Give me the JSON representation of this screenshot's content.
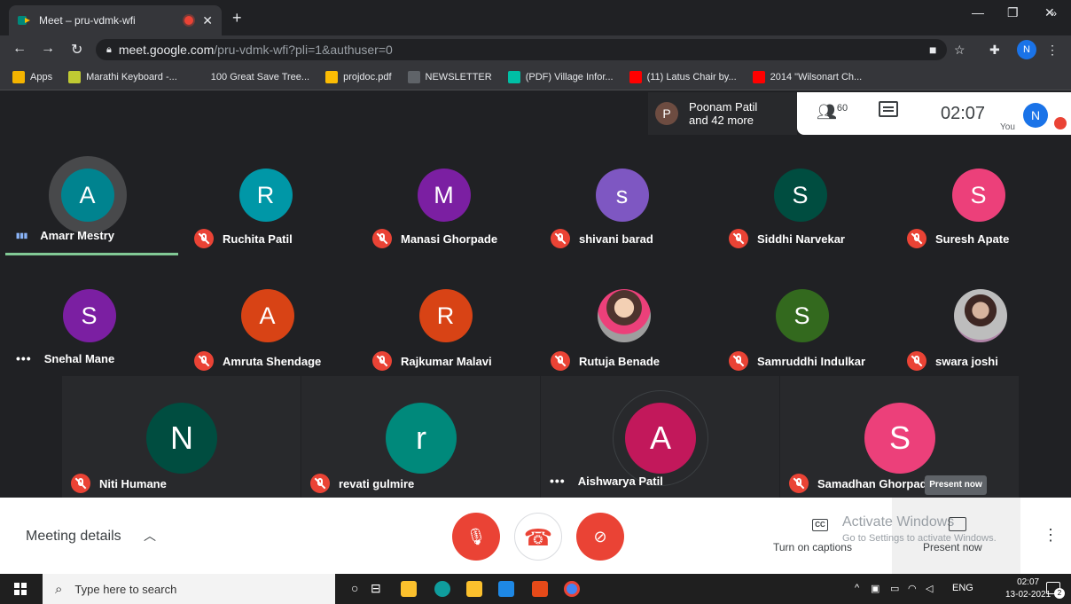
{
  "browser": {
    "tab_title": "Meet – pru-vdmk-wfi",
    "tab_close": "✕",
    "new_tab": "+",
    "url_host": "meet.google.com",
    "url_path": "/pru-vdmk-wfi?pli=1&authuser=0",
    "profile_initial": "N"
  },
  "bookmarks": [
    {
      "label": "Apps",
      "color": "#f4b400"
    },
    {
      "label": "Marathi Keyboard -...",
      "color": "#c0ca33"
    },
    {
      "label": "100 Great Save Tree...",
      "color": "#35363a"
    },
    {
      "label": "projdoc.pdf",
      "color": "#fbbc04"
    },
    {
      "label": "NEWSLETTER",
      "color": "#5f6368"
    },
    {
      "label": "(PDF) Village Infor...",
      "color": "#00bfa5"
    },
    {
      "label": "(11) Latus Chair by...",
      "color": "#ff0000"
    },
    {
      "label": "2014 \"Wilsonart Ch...",
      "color": "#ff0000"
    }
  ],
  "bookmarks_more": "»",
  "presenter": {
    "initial": "P",
    "line1": "Poonam Patil",
    "line2": "and 42 more"
  },
  "info": {
    "people_count": "60",
    "time": "02:07",
    "you_label": "You",
    "me_initial": "N"
  },
  "participants": [
    {
      "initial": "A",
      "name": "Amarr Mestry",
      "color": "#00838f",
      "status": "speaking"
    },
    {
      "initial": "R",
      "name": "Ruchita Patil",
      "color": "#0097a7",
      "status": "muted"
    },
    {
      "initial": "M",
      "name": "Manasi Ghorpade",
      "color": "#7b1fa2",
      "status": "muted"
    },
    {
      "initial": "s",
      "name": "shivani barad",
      "color": "#7e57c2",
      "status": "muted"
    },
    {
      "initial": "S",
      "name": "Siddhi Narvekar",
      "color": "#004d40",
      "status": "muted"
    },
    {
      "initial": "S",
      "name": "Suresh Apate",
      "color": "#ec407a",
      "status": "muted"
    },
    {
      "initial": "S",
      "name": "Snehal Mane",
      "color": "#7b1fa2",
      "status": "dots"
    },
    {
      "initial": "A",
      "name": "Amruta Shendage",
      "color": "#d84315",
      "status": "muted"
    },
    {
      "initial": "R",
      "name": "Rajkumar Malavi",
      "color": "#d84315",
      "status": "muted"
    },
    {
      "initial": "",
      "name": "Rutuja Benade",
      "color": "#8d6e63",
      "status": "muted"
    },
    {
      "initial": "S",
      "name": "Samruddhi Indulkar",
      "color": "#33691e",
      "status": "muted"
    },
    {
      "initial": "",
      "name": "swara joshi",
      "color": "#ad8fa5",
      "status": "muted"
    },
    {
      "initial": "N",
      "name": "Niti Humane",
      "color": "#004d40",
      "status": "muted"
    },
    {
      "initial": "r",
      "name": "revati gulmire",
      "color": "#00897b",
      "status": "muted"
    },
    {
      "initial": "A",
      "name": "Aishwarya Patil",
      "color": "#c2185b",
      "status": "dots"
    },
    {
      "initial": "S",
      "name": "Samadhan Ghorpade",
      "color": "#ec407a",
      "status": "muted"
    }
  ],
  "bottom": {
    "meeting_details": "Meeting details",
    "captions_label": "Turn on captions",
    "cc": "CC",
    "present_label": "Present now",
    "present_tooltip": "Present now",
    "activate_title": "Activate Windows",
    "activate_sub": "Go to Settings to activate Windows."
  },
  "taskbar": {
    "search_placeholder": "Type here to search",
    "lang": "ENG",
    "time": "02:07",
    "date": "13-02-2021",
    "notif_count": "2"
  }
}
